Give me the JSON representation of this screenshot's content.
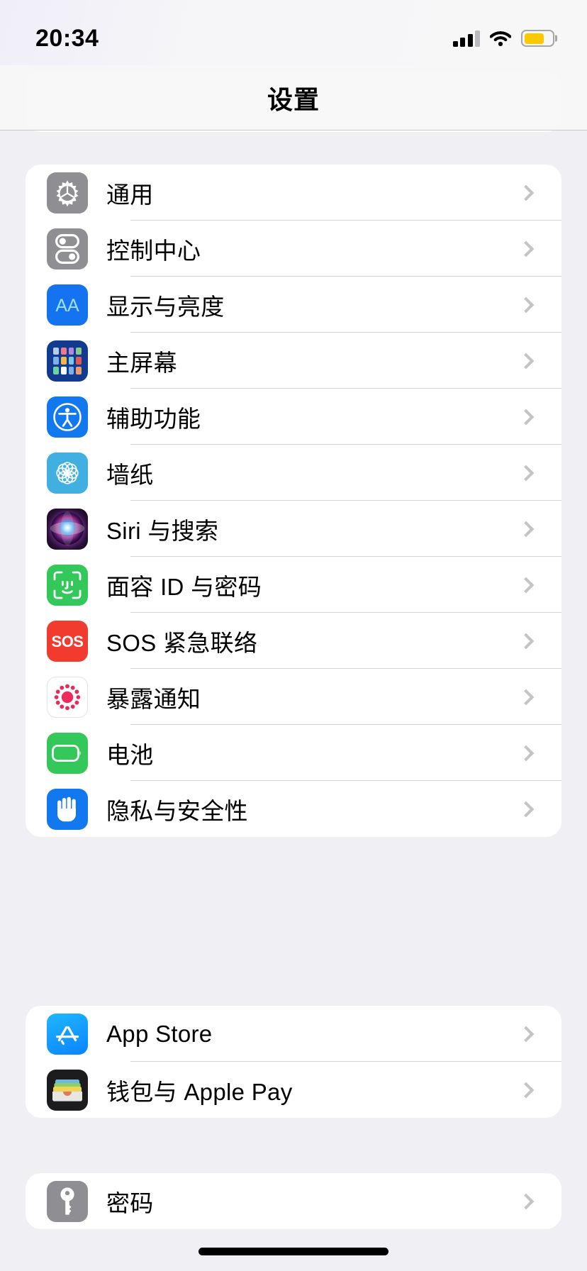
{
  "status_bar": {
    "time": "20:34",
    "signal_icon": "cellular-signal-icon",
    "signal_bars_filled": 3,
    "signal_bars_total": 4,
    "wifi_icon": "wifi-icon",
    "battery_icon": "battery-icon",
    "battery_color": "#fbc900",
    "battery_level_percent": 72
  },
  "nav": {
    "title": "设置"
  },
  "groups": [
    {
      "id": "system-group",
      "rows": [
        {
          "label": "通用",
          "icon": "gear-icon",
          "icon_class": "ic-gear"
        },
        {
          "label": "控制中心",
          "icon": "control-center-icon",
          "icon_class": "ic-control"
        },
        {
          "label": "显示与亮度",
          "icon": "display-brightness-icon",
          "icon_class": "ic-display"
        },
        {
          "label": "主屏幕",
          "icon": "home-screen-icon",
          "icon_class": "ic-home"
        },
        {
          "label": "辅助功能",
          "icon": "accessibility-icon",
          "icon_class": "ic-access"
        },
        {
          "label": "墙纸",
          "icon": "wallpaper-icon",
          "icon_class": "ic-wallpaper"
        },
        {
          "label": "Siri 与搜索",
          "icon": "siri-icon",
          "icon_class": "ic-siri"
        },
        {
          "label": "面容 ID 与密码",
          "icon": "face-id-icon",
          "icon_class": "ic-faceid"
        },
        {
          "label": "SOS 紧急联络",
          "icon": "emergency-sos-icon",
          "icon_class": "ic-sos"
        },
        {
          "label": "暴露通知",
          "icon": "exposure-notifications-icon",
          "icon_class": "ic-exposure"
        },
        {
          "label": "电池",
          "icon": "battery-settings-icon",
          "icon_class": "ic-battery"
        },
        {
          "label": "隐私与安全性",
          "icon": "privacy-hand-icon",
          "icon_class": "ic-privacy"
        }
      ]
    },
    {
      "id": "store-group",
      "rows": [
        {
          "label": "App Store",
          "icon": "app-store-icon",
          "icon_class": "ic-appstore"
        },
        {
          "label": "钱包与 Apple Pay",
          "icon": "wallet-icon",
          "icon_class": "ic-wallet"
        }
      ]
    },
    {
      "id": "passwords-group",
      "rows": [
        {
          "label": "密码",
          "icon": "key-icon",
          "icon_class": "ic-passwords"
        }
      ]
    }
  ],
  "chevron_icon": "chevron-right-icon",
  "home_indicator": "home-indicator"
}
